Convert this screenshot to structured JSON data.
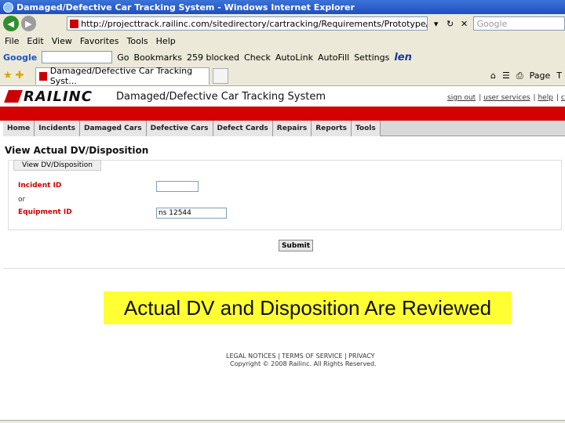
{
  "window": {
    "title": "Damaged/Defective Car Tracking System - Windows Internet Explorer"
  },
  "address_bar": {
    "url": "http://projecttrack.railinc.com/sitedirectory/cartracking/Requirements/Prototype/ddcts_proto",
    "search_placeholder": "Google"
  },
  "menu": {
    "items": [
      "File",
      "Edit",
      "View",
      "Favorites",
      "Tools",
      "Help"
    ]
  },
  "google_toolbar": {
    "logo": "Google",
    "go": "Go",
    "bookmarks": "Bookmarks",
    "blocked": "259 blocked",
    "check": "Check",
    "autolink": "AutoLink",
    "autofill": "AutoFill",
    "settings": "Settings",
    "brand": "len"
  },
  "tab": {
    "label": "Damaged/Defective Car Tracking Syst...",
    "page": "Page",
    "tools": "T"
  },
  "site": {
    "logo": "RAILINC",
    "title": "Damaged/Defective Car Tracking System",
    "top_links": [
      "sign out",
      "user services",
      "help",
      "con"
    ],
    "nav": [
      "Home",
      "Incidents",
      "Damaged Cars",
      "Defective Cars",
      "Defect Cards",
      "Repairs",
      "Reports",
      "Tools"
    ],
    "page_heading": "View Actual DV/Disposition",
    "panel_tab": "View DV/Disposition",
    "incident_label": "Incident ID",
    "or_label": "or",
    "equipment_label": "Equipment ID",
    "incident_value": "",
    "equipment_value": "ns 12544",
    "submit": "Submit",
    "caption": "Actual DV and Disposition Are Reviewed",
    "footer_links": "LEGAL NOTICES | TERMS OF SERVICE | PRIVACY",
    "footer_copy": "Copyright © 2008 Railinc. All Rights Reserved."
  }
}
